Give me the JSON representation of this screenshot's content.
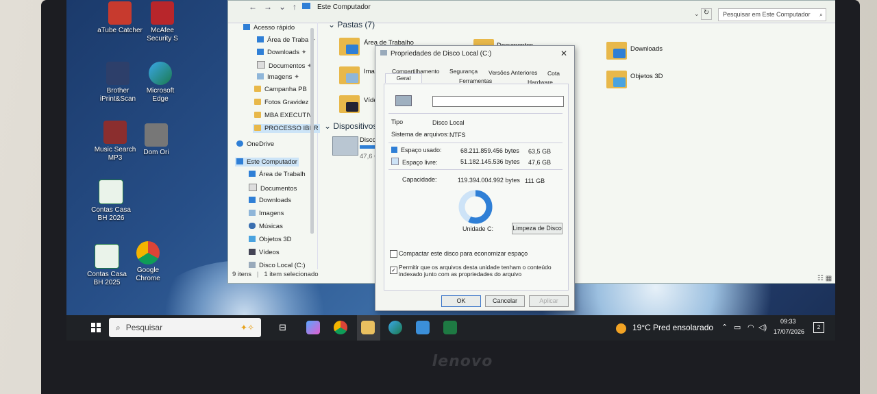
{
  "desktop_icons": [
    {
      "label": "aTube Catcher"
    },
    {
      "label": "McAfee Security S"
    },
    {
      "label": "Brother iPrint&Scan"
    },
    {
      "label": "Microsoft Edge"
    },
    {
      "label": "Music Search MP3"
    },
    {
      "label": "Dom Ori"
    },
    {
      "label": "Contas Casa BH 2026"
    },
    {
      "label": "Contas Casa BH 2025"
    },
    {
      "label": "Google Chrome"
    }
  ],
  "explorer": {
    "path": "Este Computador",
    "search_placeholder": "Pesquisar em Este Computador",
    "nav": [
      {
        "label": "Acesso rápido"
      },
      {
        "label": "Área de Traba"
      },
      {
        "label": "Downloads"
      },
      {
        "label": "Documentos"
      },
      {
        "label": "Imagens"
      },
      {
        "label": "Campanha PB"
      },
      {
        "label": "Fotos Gravidez"
      },
      {
        "label": "MBA EXECUTIV"
      },
      {
        "label": "PROCESSO IBER"
      },
      {
        "label": "OneDrive"
      },
      {
        "label": "Este Computador"
      },
      {
        "label": "Área de Trabalh"
      },
      {
        "label": "Documentos"
      },
      {
        "label": "Downloads"
      },
      {
        "label": "Imagens"
      },
      {
        "label": "Músicas"
      },
      {
        "label": "Objetos 3D"
      },
      {
        "label": "Vídeos"
      },
      {
        "label": "Disco Local (C:)"
      }
    ],
    "status_items": "9 itens",
    "status_selected": "1 item selecionado",
    "section_folders": "Pastas (7)",
    "section_devices": "Dispositivos e",
    "folders": [
      {
        "label": "Área de Trabalho"
      },
      {
        "label": "Documentos"
      },
      {
        "label": "Downloads"
      },
      {
        "label": "Image"
      },
      {
        "label": "Objetos 3D"
      },
      {
        "label": "Víde"
      }
    ],
    "drive_label": "Disco L",
    "drive_size": "47,6 GB"
  },
  "dialog": {
    "title": "Propriedades de Disco Local (C:)",
    "tabs_row1": [
      "Compartilhamento",
      "Segurança",
      "Versões Anteriores",
      "Cota"
    ],
    "tabs_row2": [
      "Geral",
      "Ferramentas",
      "Hardware"
    ],
    "name_value": "",
    "type_label": "Tipo",
    "type_value": "Disco Local",
    "fs_label": "Sistema de arquivos:",
    "fs_value": "NTFS",
    "used_label": "Espaço usado:",
    "used_bytes": "68.211.859.456 bytes",
    "used_gb": "63,5 GB",
    "free_label": "Espaço livre:",
    "free_bytes": "51.182.145.536 bytes",
    "free_gb": "47,6 GB",
    "capacity_label": "Capacidade:",
    "capacity_bytes": "119.394.004.992 bytes",
    "capacity_gb": "111 GB",
    "used_fraction": 0.571,
    "drive_label": "Unidade C:",
    "cleanup_button": "Limpeza de Disco",
    "compress_label": "Compactar este disco para economizar espaço",
    "compress_checked": false,
    "index_label": "Permitir que os arquivos desta unidade tenham o conteúdo indexado junto com as propriedades do arquivo",
    "index_checked": true,
    "ok": "OK",
    "cancel": "Cancelar",
    "apply": "Aplicar",
    "used_color": "#2f7fd6",
    "free_color": "#cde3f7"
  },
  "taskbar": {
    "search_label": "Pesquisar",
    "weather_temp": "19°C",
    "weather_desc": "Pred ensolarado",
    "time": "09:33",
    "date": "17/07/2026",
    "notifications": "2"
  },
  "brand": "lenovo"
}
